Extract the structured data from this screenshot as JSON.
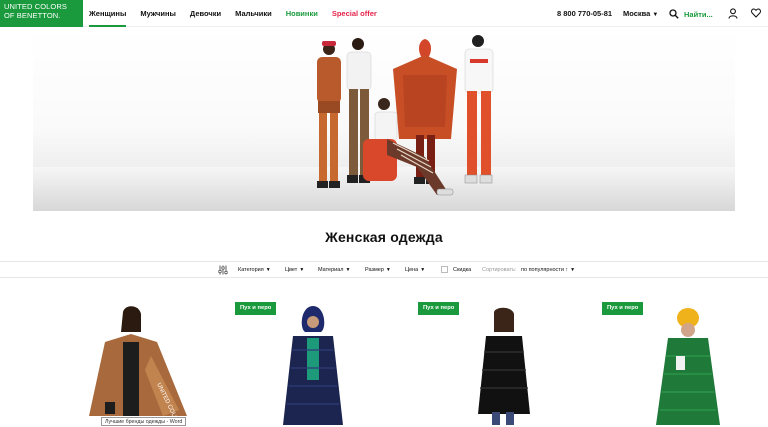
{
  "header": {
    "logo_lines": [
      "UNITED COLORS",
      "OF BENETTON."
    ],
    "nav": [
      {
        "label": "Женщины",
        "active": true,
        "color": "#111111"
      },
      {
        "label": "Мужчины",
        "active": false,
        "color": "#111111"
      },
      {
        "label": "Девочки",
        "active": false,
        "color": "#111111"
      },
      {
        "label": "Мальчики",
        "active": false,
        "color": "#111111"
      },
      {
        "label": "Новинки",
        "active": false,
        "color": "#1a9a3d"
      },
      {
        "label": "Special offer",
        "active": false,
        "color": "#e4254b"
      }
    ],
    "phone": "8 800 770-05-81",
    "city": "Москва",
    "search_label": "Найти...",
    "icons": [
      "search-icon",
      "user-icon",
      "heart-icon"
    ]
  },
  "page": {
    "title": "Женская одежда"
  },
  "filters": {
    "icon": "filter-sliders-icon",
    "items": [
      "Категория",
      "Цвет",
      "Материал",
      "Размер",
      "Цена"
    ],
    "discount_label": "Скидка",
    "sort_label": "Сортировать:",
    "sort_value": "по популярности ↑"
  },
  "products": [
    {
      "badge": "",
      "item": "camel-cape-coat"
    },
    {
      "badge": "Пух и перо",
      "item": "navy-long-puffer"
    },
    {
      "badge": "Пух и перо",
      "item": "black-puffer"
    },
    {
      "badge": "Пух и перо",
      "item": "green-long-puffer"
    }
  ],
  "tooltip": "Лучшие бренды одежды - Word",
  "colors": {
    "brand_green": "#1a9a3d",
    "special_red": "#e4254b"
  }
}
